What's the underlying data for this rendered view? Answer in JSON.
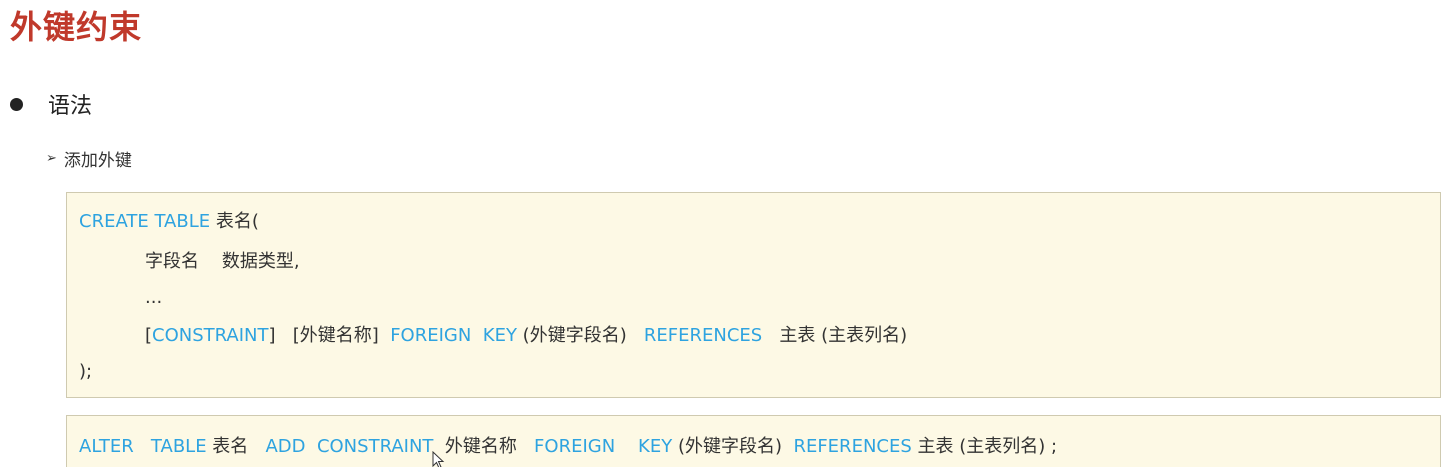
{
  "title": "外键约束",
  "bullet": {
    "label": "语法"
  },
  "sub": {
    "label": "添加外键"
  },
  "code1": {
    "l1_kw": "CREATE TABLE",
    "l1_txt": " 表名(",
    "l2_txt": "字段名    数据类型,",
    "l3_txt": "...",
    "l4_b1": "[",
    "l4_kw1": "CONSTRAINT",
    "l4_t1": "]   [外键名称]  ",
    "l4_kw2": "FOREIGN  KEY",
    "l4_t2": " (外键字段名)   ",
    "l4_kw3": "REFERENCES",
    "l4_t3": "   主表 (主表列名)",
    "l5_txt": ");"
  },
  "code2": {
    "kw1": "ALTER   TABLE",
    "t1": " 表名   ",
    "kw2": "ADD  CONSTRAINT",
    "t2": "  外键名称   ",
    "kw3": "FOREIGN    KEY",
    "t3": " (外键字段名)  ",
    "kw4": "REFERENCES",
    "t4": " 主表 (主表列名) ;"
  },
  "colors": {
    "title": "#c0392b",
    "keyword": "#2ea3e0",
    "code_bg": "#fdf9e5"
  }
}
